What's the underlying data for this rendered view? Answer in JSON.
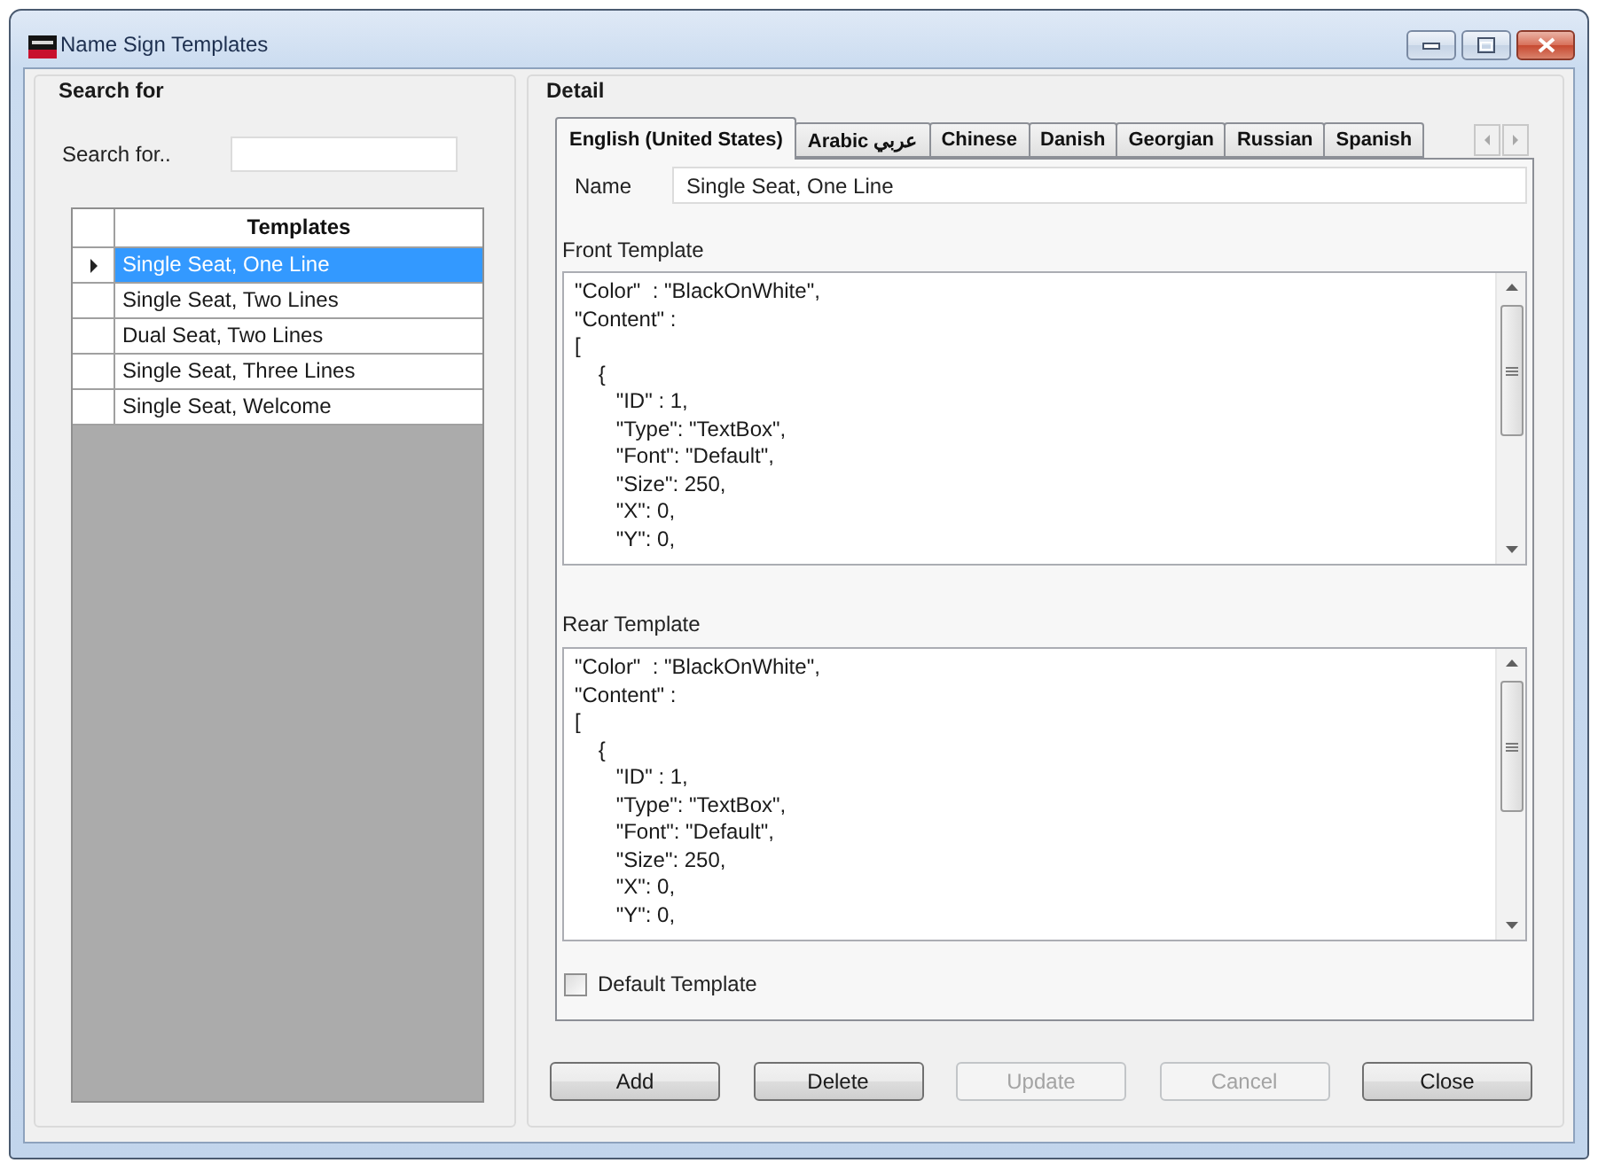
{
  "window": {
    "title": "Name Sign Templates"
  },
  "search": {
    "heading": "Search for",
    "label": "Search for.."
  },
  "templates": {
    "column": "Templates",
    "rows": [
      {
        "name": "Single Seat, One Line",
        "selected": true
      },
      {
        "name": "Single Seat, Two Lines",
        "selected": false
      },
      {
        "name": "Dual Seat, Two Lines",
        "selected": false
      },
      {
        "name": "Single Seat, Three Lines",
        "selected": false
      },
      {
        "name": "Single Seat, Welcome",
        "selected": false
      }
    ]
  },
  "detail": {
    "heading": "Detail",
    "tabs": [
      {
        "label": "English (United States)",
        "selected": true
      },
      {
        "label": "Arabic عربي",
        "selected": false
      },
      {
        "label": "Chinese",
        "selected": false
      },
      {
        "label": "Danish",
        "selected": false
      },
      {
        "label": "Georgian",
        "selected": false
      },
      {
        "label": "Russian",
        "selected": false
      },
      {
        "label": "Spanish",
        "selected": false
      }
    ],
    "name": {
      "label": "Name",
      "value": "Single Seat, One Line"
    },
    "front_template": {
      "label": "Front Template",
      "text": "\"Color\"  : \"BlackOnWhite\",\n\"Content\" :\n[\n    {\n       \"ID\" : 1,\n       \"Type\": \"TextBox\",\n       \"Font\": \"Default\",\n       \"Size\": 250,\n       \"X\": 0,\n       \"Y\": 0,"
    },
    "rear_template": {
      "label": "Rear Template",
      "text": "\"Color\"  : \"BlackOnWhite\",\n\"Content\" :\n[\n    {\n       \"ID\" : 1,\n       \"Type\": \"TextBox\",\n       \"Font\": \"Default\",\n       \"Size\": 250,\n       \"X\": 0,\n       \"Y\": 0,"
    },
    "default_template": {
      "label": "Default Template",
      "checked": false
    }
  },
  "buttons": [
    {
      "label": "Add",
      "disabled": false
    },
    {
      "label": "Delete",
      "disabled": false
    },
    {
      "label": "Update",
      "disabled": true
    },
    {
      "label": "Cancel",
      "disabled": true
    },
    {
      "label": "Close",
      "disabled": false
    }
  ]
}
